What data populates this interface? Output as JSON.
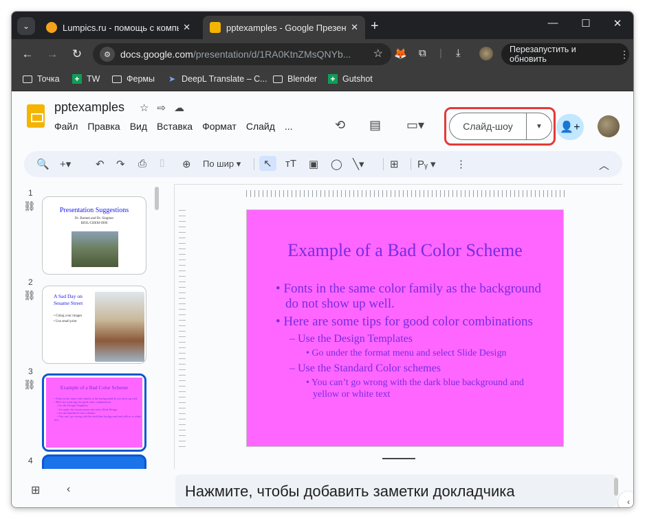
{
  "browser": {
    "tabs": [
      {
        "title": "Lumpics.ru - помощь с компьют",
        "favicon_color": "#f6a21b",
        "active": false
      },
      {
        "title": "pptexamples - Google Презентац",
        "favicon_color": "#f4b400",
        "active": true
      }
    ],
    "new_tab": "+",
    "window_controls": {
      "minimize": "—",
      "maximize": "☐",
      "close": "✕"
    },
    "url_domain": "docs.google.com",
    "url_path": "/presentation/d/1RA0KtnZMsQNYb...",
    "restart_label": "Перезапустить и обновить",
    "bookmarks": [
      {
        "label": "Точка",
        "icon": "folder-icon"
      },
      {
        "label": "TW",
        "icon": "plus-icon"
      },
      {
        "label": "Фермы",
        "icon": "folder-icon"
      },
      {
        "label": "DeepL Translate – C...",
        "icon": "deepl-icon"
      },
      {
        "label": "Blender",
        "icon": "folder-icon"
      },
      {
        "label": "Gutshot",
        "icon": "plus-icon"
      }
    ]
  },
  "doc": {
    "title": "pptexamples",
    "menu": [
      "Файл",
      "Правка",
      "Вид",
      "Вставка",
      "Формат",
      "Слайд",
      "..."
    ],
    "slideshow_label": "Слайд-шоу",
    "zoom_label": "По шир",
    "highlight_color": "#e53935"
  },
  "thumbnails": [
    {
      "number": "1",
      "title": "Presentation Suggestions",
      "subtitle": "Dr. Barnett and Dr. Singmar",
      "subtitle2": "BIOL/CHEM 6900"
    },
    {
      "number": "2",
      "title": "A Sad Day on Sesame Street",
      "bullets": [
        "Citing your images",
        "Use small print"
      ]
    },
    {
      "number": "3",
      "title": "Example of a Bad Color Scheme"
    },
    {
      "number": "4"
    }
  ],
  "slide": {
    "background": "#ff66ff",
    "text_color": "#7a2be0",
    "title": "Example of a Bad Color Scheme",
    "bullets": [
      {
        "level": 1,
        "marker": "•",
        "text": "Fonts in the same color family as the background do not show up well."
      },
      {
        "level": 1,
        "marker": "•",
        "text": "Here are some tips for good color combinations"
      },
      {
        "level": 2,
        "marker": "–",
        "text": "Use the Design Templates"
      },
      {
        "level": 3,
        "marker": "•",
        "text": "Go under the format menu and select Slide Design"
      },
      {
        "level": 2,
        "marker": "–",
        "text": "Use the Standard Color schemes"
      },
      {
        "level": 3,
        "marker": "•",
        "text": "You can’t go wrong with the dark blue background and yellow or white text"
      }
    ]
  },
  "notes_placeholder": "Нажмите, чтобы добавить заметки докладчика"
}
